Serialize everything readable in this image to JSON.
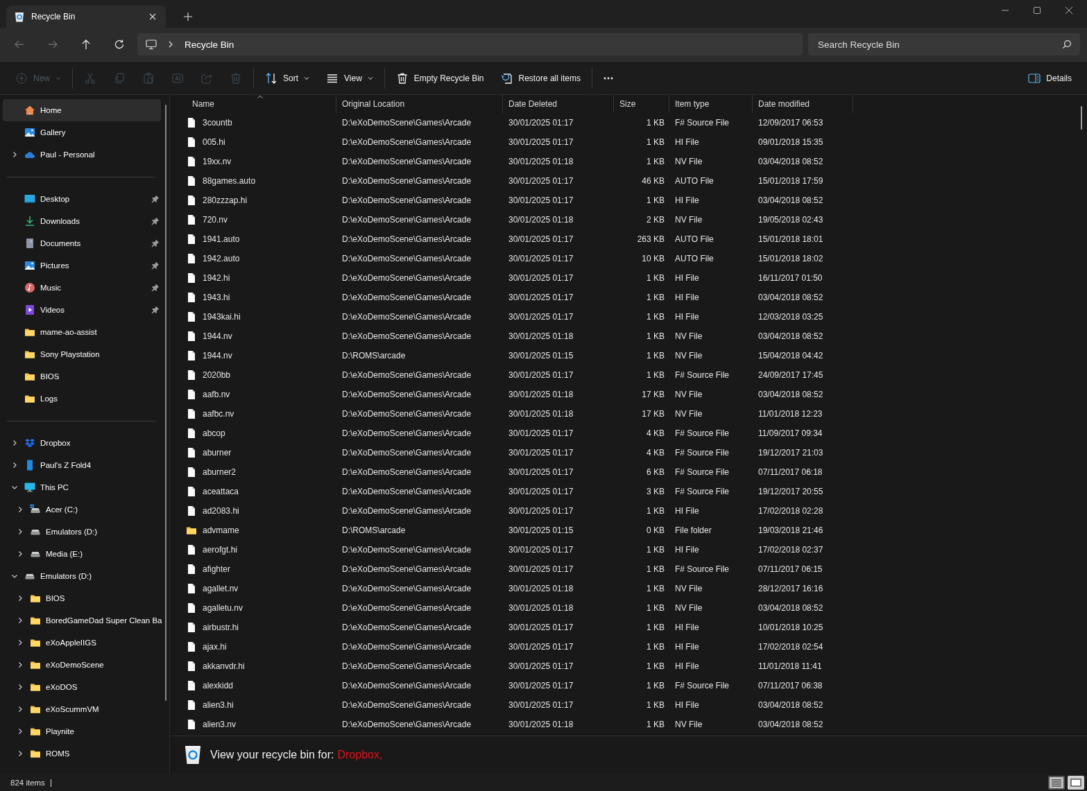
{
  "window": {
    "tab_title": "Recycle Bin"
  },
  "nav": [
    {
      "kind": "back",
      "disabled": true
    },
    {
      "kind": "forward",
      "disabled": true
    },
    {
      "kind": "up",
      "disabled": false
    },
    {
      "kind": "refresh",
      "disabled": false
    }
  ],
  "address": {
    "crumbs": [
      "Recycle Bin"
    ]
  },
  "search": {
    "placeholder": "Search Recycle Bin"
  },
  "toolbar": [
    {
      "kind": "new",
      "label": "New",
      "disabled": true
    },
    {
      "kind": "sep"
    },
    {
      "kind": "cut",
      "disabled": true
    },
    {
      "kind": "copy",
      "disabled": true
    },
    {
      "kind": "paste",
      "disabled": true
    },
    {
      "kind": "rename",
      "disabled": true
    },
    {
      "kind": "share",
      "disabled": true
    },
    {
      "kind": "delete",
      "disabled": true
    },
    {
      "kind": "sep"
    },
    {
      "kind": "sort",
      "label": "Sort",
      "disabled": false
    },
    {
      "kind": "view",
      "label": "View",
      "disabled": false
    },
    {
      "kind": "sep"
    },
    {
      "kind": "empty",
      "label": "Empty Recycle Bin",
      "disabled": false
    },
    {
      "kind": "restore",
      "label": "Restore all items",
      "disabled": false
    },
    {
      "kind": "sep"
    },
    {
      "kind": "more",
      "disabled": false
    }
  ],
  "details_button": "Details",
  "sidebar": {
    "groups": [
      {
        "items": [
          {
            "label": "Home",
            "kind": "home",
            "selected": true
          },
          {
            "label": "Gallery",
            "kind": "gallery",
            "selected": false
          },
          {
            "label": "Paul - Personal",
            "kind": "cloud",
            "selected": false,
            "expanded": false
          }
        ]
      },
      {
        "items": [
          {
            "label": "Desktop",
            "kind": "desktop",
            "selected": false,
            "pinned": true
          },
          {
            "label": "Downloads",
            "kind": "download",
            "selected": false,
            "pinned": true
          },
          {
            "label": "Documents",
            "kind": "document",
            "selected": false,
            "pinned": true
          },
          {
            "label": "Pictures",
            "kind": "gallery",
            "selected": false,
            "pinned": true
          },
          {
            "label": "Music",
            "kind": "music",
            "selected": false,
            "pinned": true
          },
          {
            "label": "Videos",
            "kind": "video",
            "selected": false,
            "pinned": true
          },
          {
            "label": "mame-ao-assist",
            "kind": "folder",
            "selected": false,
            "pinned": false
          },
          {
            "label": "Sony Playstation",
            "kind": "folder",
            "selected": false,
            "pinned": false
          },
          {
            "label": "BIOS",
            "kind": "folder",
            "selected": false,
            "pinned": false
          },
          {
            "label": "Logs",
            "kind": "folder",
            "selected": false,
            "pinned": false
          }
        ]
      },
      {
        "items": [
          {
            "label": "Dropbox",
            "kind": "dropbox",
            "selected": false,
            "expanded": false
          },
          {
            "label": "Paul's Z Fold4",
            "kind": "phone",
            "selected": false,
            "expanded": false
          },
          {
            "label": "This PC",
            "kind": "monitor",
            "selected": false,
            "expanded": true,
            "children": [
              {
                "label": "Acer (C:)",
                "kind": "windrive",
                "selected": false,
                "expanded": false
              },
              {
                "label": "Emulators (D:)",
                "kind": "drive",
                "selected": false,
                "expanded": false
              },
              {
                "label": "Media (E:)",
                "kind": "drive",
                "selected": false,
                "expanded": false
              }
            ]
          },
          {
            "label": "Emulators (D:)",
            "kind": "drive",
            "selected": false,
            "expanded": true,
            "children": [
              {
                "label": "BIOS",
                "kind": "folder",
                "selected": false,
                "expanded": false
              },
              {
                "label": "BoredGameDad Super Clean Ba",
                "kind": "folder",
                "selected": false,
                "expanded": false
              },
              {
                "label": "eXoAppleIIGS",
                "kind": "folder",
                "selected": false,
                "expanded": false
              },
              {
                "label": "eXoDemoScene",
                "kind": "folder",
                "selected": false,
                "expanded": false
              },
              {
                "label": "eXoDOS",
                "kind": "folder",
                "selected": false,
                "expanded": false
              },
              {
                "label": "eXoScummVM",
                "kind": "folder",
                "selected": false,
                "expanded": false
              },
              {
                "label": "Playnite",
                "kind": "folder",
                "selected": false,
                "expanded": false
              },
              {
                "label": "ROMS",
                "kind": "folder",
                "selected": false,
                "expanded": false
              }
            ]
          }
        ]
      }
    ]
  },
  "table": {
    "columns": [
      {
        "label": "Name",
        "sorted": true
      },
      {
        "label": "Original Location",
        "sorted": false
      },
      {
        "label": "Date Deleted",
        "sorted": false
      },
      {
        "label": "Size",
        "sorted": false
      },
      {
        "label": "Item type",
        "sorted": false
      },
      {
        "label": "Date modified",
        "sorted": false
      }
    ],
    "rows": [
      {
        "kind": "file",
        "cells": [
          "3countb",
          "D:\\eXoDemoScene\\Games\\Arcade",
          "30/01/2025 01:17",
          "1 KB",
          "F# Source File",
          "12/09/2017 06:53"
        ]
      },
      {
        "kind": "file",
        "cells": [
          "005.hi",
          "D:\\eXoDemoScene\\Games\\Arcade",
          "30/01/2025 01:17",
          "1 KB",
          "HI File",
          "09/01/2018 15:35"
        ]
      },
      {
        "kind": "file",
        "cells": [
          "19xx.nv",
          "D:\\eXoDemoScene\\Games\\Arcade",
          "30/01/2025 01:18",
          "1 KB",
          "NV File",
          "03/04/2018 08:52"
        ]
      },
      {
        "kind": "file",
        "cells": [
          "88games.auto",
          "D:\\eXoDemoScene\\Games\\Arcade",
          "30/01/2025 01:17",
          "46 KB",
          "AUTO File",
          "15/01/2018 17:59"
        ]
      },
      {
        "kind": "file",
        "cells": [
          "280zzzap.hi",
          "D:\\eXoDemoScene\\Games\\Arcade",
          "30/01/2025 01:17",
          "1 KB",
          "HI File",
          "03/04/2018 08:52"
        ]
      },
      {
        "kind": "file",
        "cells": [
          "720.nv",
          "D:\\eXoDemoScene\\Games\\Arcade",
          "30/01/2025 01:18",
          "2 KB",
          "NV File",
          "19/05/2018 02:43"
        ]
      },
      {
        "kind": "file",
        "cells": [
          "1941.auto",
          "D:\\eXoDemoScene\\Games\\Arcade",
          "30/01/2025 01:17",
          "263 KB",
          "AUTO File",
          "15/01/2018 18:01"
        ]
      },
      {
        "kind": "file",
        "cells": [
          "1942.auto",
          "D:\\eXoDemoScene\\Games\\Arcade",
          "30/01/2025 01:17",
          "10 KB",
          "AUTO File",
          "15/01/2018 18:02"
        ]
      },
      {
        "kind": "file",
        "cells": [
          "1942.hi",
          "D:\\eXoDemoScene\\Games\\Arcade",
          "30/01/2025 01:17",
          "1 KB",
          "HI File",
          "16/11/2017 01:50"
        ]
      },
      {
        "kind": "file",
        "cells": [
          "1943.hi",
          "D:\\eXoDemoScene\\Games\\Arcade",
          "30/01/2025 01:17",
          "1 KB",
          "HI File",
          "03/04/2018 08:52"
        ]
      },
      {
        "kind": "file",
        "cells": [
          "1943kai.hi",
          "D:\\eXoDemoScene\\Games\\Arcade",
          "30/01/2025 01:17",
          "1 KB",
          "HI File",
          "12/03/2018 03:25"
        ]
      },
      {
        "kind": "file",
        "cells": [
          "1944.nv",
          "D:\\eXoDemoScene\\Games\\Arcade",
          "30/01/2025 01:18",
          "1 KB",
          "NV File",
          "03/04/2018 08:52"
        ]
      },
      {
        "kind": "file",
        "cells": [
          "1944.nv",
          "D:\\ROMS\\arcade",
          "30/01/2025 01:15",
          "1 KB",
          "NV File",
          "15/04/2018 04:42"
        ]
      },
      {
        "kind": "file",
        "cells": [
          "2020bb",
          "D:\\eXoDemoScene\\Games\\Arcade",
          "30/01/2025 01:17",
          "1 KB",
          "F# Source File",
          "24/09/2017 17:45"
        ]
      },
      {
        "kind": "file",
        "cells": [
          "aafb.nv",
          "D:\\eXoDemoScene\\Games\\Arcade",
          "30/01/2025 01:18",
          "17 KB",
          "NV File",
          "03/04/2018 08:52"
        ]
      },
      {
        "kind": "file",
        "cells": [
          "aafbc.nv",
          "D:\\eXoDemoScene\\Games\\Arcade",
          "30/01/2025 01:18",
          "17 KB",
          "NV File",
          "11/01/2018 12:23"
        ]
      },
      {
        "kind": "file",
        "cells": [
          "abcop",
          "D:\\eXoDemoScene\\Games\\Arcade",
          "30/01/2025 01:17",
          "4 KB",
          "F# Source File",
          "11/09/2017 09:34"
        ]
      },
      {
        "kind": "file",
        "cells": [
          "aburner",
          "D:\\eXoDemoScene\\Games\\Arcade",
          "30/01/2025 01:17",
          "4 KB",
          "F# Source File",
          "19/12/2017 21:03"
        ]
      },
      {
        "kind": "file",
        "cells": [
          "aburner2",
          "D:\\eXoDemoScene\\Games\\Arcade",
          "30/01/2025 01:17",
          "6 KB",
          "F# Source File",
          "07/11/2017 06:18"
        ]
      },
      {
        "kind": "file",
        "cells": [
          "aceattaca",
          "D:\\eXoDemoScene\\Games\\Arcade",
          "30/01/2025 01:17",
          "3 KB",
          "F# Source File",
          "19/12/2017 20:55"
        ]
      },
      {
        "kind": "file",
        "cells": [
          "ad2083.hi",
          "D:\\eXoDemoScene\\Games\\Arcade",
          "30/01/2025 01:17",
          "1 KB",
          "HI File",
          "17/02/2018 02:28"
        ]
      },
      {
        "kind": "folder",
        "cells": [
          "advmame",
          "D:\\ROMS\\arcade",
          "30/01/2025 01:15",
          "0 KB",
          "File folder",
          "19/03/2018 21:46"
        ]
      },
      {
        "kind": "file",
        "cells": [
          "aerofgt.hi",
          "D:\\eXoDemoScene\\Games\\Arcade",
          "30/01/2025 01:17",
          "1 KB",
          "HI File",
          "17/02/2018 02:37"
        ]
      },
      {
        "kind": "file",
        "cells": [
          "afighter",
          "D:\\eXoDemoScene\\Games\\Arcade",
          "30/01/2025 01:17",
          "1 KB",
          "F# Source File",
          "07/11/2017 06:15"
        ]
      },
      {
        "kind": "file",
        "cells": [
          "agallet.nv",
          "D:\\eXoDemoScene\\Games\\Arcade",
          "30/01/2025 01:18",
          "1 KB",
          "NV File",
          "28/12/2017 16:16"
        ]
      },
      {
        "kind": "file",
        "cells": [
          "agalletu.nv",
          "D:\\eXoDemoScene\\Games\\Arcade",
          "30/01/2025 01:18",
          "1 KB",
          "NV File",
          "03/04/2018 08:52"
        ]
      },
      {
        "kind": "file",
        "cells": [
          "airbustr.hi",
          "D:\\eXoDemoScene\\Games\\Arcade",
          "30/01/2025 01:17",
          "1 KB",
          "HI File",
          "10/01/2018 10:25"
        ]
      },
      {
        "kind": "file",
        "cells": [
          "ajax.hi",
          "D:\\eXoDemoScene\\Games\\Arcade",
          "30/01/2025 01:17",
          "1 KB",
          "HI File",
          "17/02/2018 02:54"
        ]
      },
      {
        "kind": "file",
        "cells": [
          "akkanvdr.hi",
          "D:\\eXoDemoScene\\Games\\Arcade",
          "30/01/2025 01:17",
          "1 KB",
          "HI File",
          "11/01/2018 11:41"
        ]
      },
      {
        "kind": "file",
        "cells": [
          "alexkidd",
          "D:\\eXoDemoScene\\Games\\Arcade",
          "30/01/2025 01:17",
          "1 KB",
          "F# Source File",
          "07/11/2017 06:38"
        ]
      },
      {
        "kind": "file",
        "cells": [
          "alien3.hi",
          "D:\\eXoDemoScene\\Games\\Arcade",
          "30/01/2025 01:17",
          "1 KB",
          "HI File",
          "03/04/2018 08:52"
        ]
      },
      {
        "kind": "file",
        "cells": [
          "alien3.nv",
          "D:\\eXoDemoScene\\Games\\Arcade",
          "30/01/2025 01:18",
          "1 KB",
          "NV File",
          "03/04/2018 08:52"
        ]
      }
    ]
  },
  "recycle_prompt": {
    "text": "View your recycle bin for:",
    "link": "Dropbox,"
  },
  "status_bar": {
    "count": "824 items"
  },
  "view_buttons": [
    {
      "kind": "details",
      "selected": true
    },
    {
      "kind": "tiles",
      "selected": false
    }
  ]
}
